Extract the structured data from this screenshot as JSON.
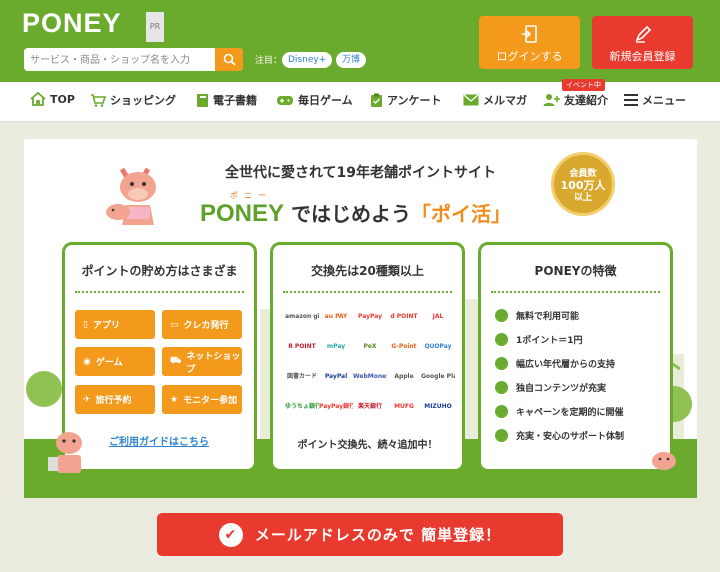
{
  "header": {
    "logo": "PONEY",
    "pr": "PR",
    "search_placeholder": "サービス・商品・ショップ名を入力",
    "attention_label": "注目：",
    "chips": [
      "Disney+",
      "万博"
    ],
    "login_label": "ログインする",
    "register_label": "新規会員登録"
  },
  "nav": {
    "items": [
      {
        "label": "TOP",
        "icon": "home-icon"
      },
      {
        "label": "ショッピング",
        "icon": "cart-icon"
      },
      {
        "label": "電子書籍",
        "icon": "book-icon"
      },
      {
        "label": "毎日ゲーム",
        "icon": "gamepad-icon"
      },
      {
        "label": "アンケート",
        "icon": "clipboard-icon"
      },
      {
        "label": "メルマガ",
        "icon": "mail-icon"
      },
      {
        "label": "友達紹介",
        "icon": "add-user-icon"
      },
      {
        "label": "メニュー",
        "icon": "menu-icon"
      }
    ],
    "event_badge": "イベント中"
  },
  "hero": {
    "tagline": "全世代に愛されて19年老舗ポイントサイト",
    "ruby": "ポニー",
    "catch_brand": "PONEY",
    "catch_mid": "ではじめよう",
    "catch_highlight": "「ポイ活」",
    "medal": [
      "会員数",
      "100万人",
      "以上"
    ]
  },
  "card_earn": {
    "title": "ポイントの貯め方はさまざま",
    "buttons": [
      "アプリ",
      "クレカ発行",
      "ゲーム",
      "ネットショップ",
      "旅行予約",
      "モニター参加"
    ],
    "guide_link": "ご利用ガイドはこちら"
  },
  "card_exchange": {
    "title": "交換先は20種類以上",
    "logos": [
      "amazon gift card",
      "au PAY",
      "PayPay",
      "d POINT",
      "JAL",
      "R POINT",
      "mPay",
      "PeX",
      "G-Point",
      "QUOPay",
      "図書カード",
      "PayPal",
      "WebMoney",
      "Apple",
      "Google Play",
      "ゆうちょ銀行",
      "PayPay銀行",
      "楽天銀行",
      "MUFG",
      "MIZUHO"
    ],
    "note": "ポイント交換先、続々追加中！"
  },
  "card_features": {
    "title": "PONEYの特徴",
    "items": [
      "無料で利用可能",
      "1ポイント＝1円",
      "幅広い年代層からの支持",
      "独自コンテンツが充実",
      "キャペーンを定期的に開催",
      "充実・安心のサポート体制"
    ]
  },
  "cta": {
    "label": "メールアドレスのみで 簡単登録！"
  },
  "colors": {
    "green": "#6aaa2c",
    "orange": "#f39a1c",
    "red": "#e83a2e"
  }
}
